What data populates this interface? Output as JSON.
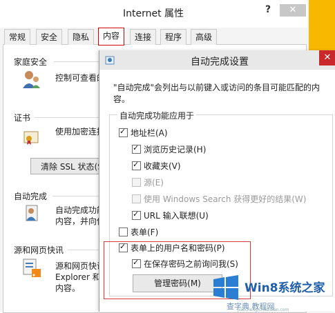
{
  "internet_options": {
    "title": "Internet 属性",
    "help": "?",
    "close": "✕",
    "tabs": [
      {
        "label": "常规"
      },
      {
        "label": "安全"
      },
      {
        "label": "隐私"
      },
      {
        "label": "内容"
      },
      {
        "label": "连接"
      },
      {
        "label": "程序"
      },
      {
        "label": "高级"
      }
    ],
    "active_tab": "内容",
    "sections": {
      "family_safety": {
        "title": "家庭安全",
        "text": "控制可查看的"
      },
      "certificates": {
        "title": "证书",
        "text": "使用加密连接",
        "ssl_button": "清除 SSL 状态(S)"
      },
      "autocomplete": {
        "title": "自动完成",
        "text_line1": "自动完成功能",
        "text_line2": "内容，并向你"
      },
      "feeds": {
        "title": "源和网页快讯",
        "text_line1": "源和网页快讯",
        "text_line2": "Explorer 和",
        "text_line3": "内容。"
      }
    }
  },
  "autocomplete_dialog": {
    "title": "自动完成设置",
    "close": "✕",
    "description": "\"自动完成\"会列出与以前键入或访问的条目可能匹配的内容。",
    "group_title": "自动完成功能应用于",
    "items": {
      "address_bar": {
        "label": "地址栏(A)",
        "checked": true
      },
      "browsing_history": {
        "label": "浏览历史记录(H)",
        "checked": true
      },
      "favorites": {
        "label": "收藏夹(V)",
        "checked": true
      },
      "feeds": {
        "label": "源(E)",
        "checked": false,
        "disabled": true
      },
      "windows_search": {
        "label": "使用 Windows Search 获得更好的结果(W)",
        "checked": false,
        "disabled": true
      },
      "url_suggestions": {
        "label": "URL 输入联想(U)",
        "checked": true
      },
      "forms": {
        "label": "表单(F)",
        "checked": false
      },
      "usernames_passwords": {
        "label": "表单上的用户名和密码(P)",
        "checked": true
      },
      "ask_before_save": {
        "label": "在保存密码之前询问我(S)",
        "checked": true
      }
    },
    "manage_passwords_button": "管理密码(M)"
  },
  "watermark": {
    "brand": "Win8系统之家",
    "sub": "查字典 教程网",
    "url": "jiaocheng.chazidian.com",
    "colors": {
      "blue": "#1f5fa8",
      "red_highlight": "#d23b3b",
      "title_close_red": "#c9292a",
      "yellow": "#f8b800"
    }
  }
}
